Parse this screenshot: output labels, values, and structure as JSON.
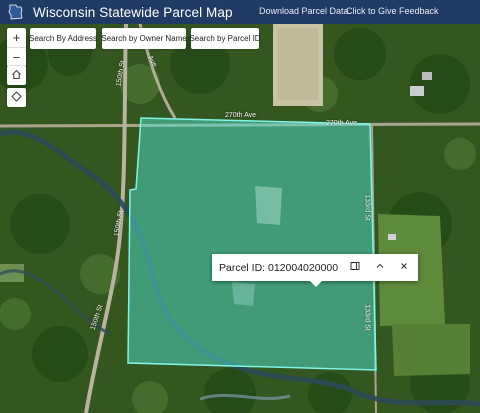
{
  "header": {
    "title": "Wisconsin Statewide Parcel Map",
    "download_link": "Download Parcel Data",
    "feedback_link": "Click to Give Feedback"
  },
  "map_controls": {
    "zoom_in": "+",
    "zoom_out": "−",
    "home_icon": "home-icon",
    "locate_icon": "locate-icon"
  },
  "search": {
    "address_label": "Search By Address",
    "owner_label": "Search by Owner Name",
    "parcel_label": "Search by Parcel ID"
  },
  "roads": {
    "road_top_left": "270th Ave",
    "road_top_right": "270th Ave",
    "road_left_top": "150th St",
    "road_left_mid": "150th St",
    "road_left_bottom": "150th St",
    "road_right_top": "133rd St",
    "road_right_bottom": "133rd St",
    "road_curve": "Ave"
  },
  "popup": {
    "title": "Parcel ID: 012004020000",
    "dock_icon": "dock-icon",
    "collapse_icon": "chevron-up-icon",
    "close_icon": "close-icon"
  },
  "colors": {
    "header_bg": "#1f3a63",
    "parcel_fill": "#4ee0d0",
    "parcel_outline": "#7ff6e8"
  }
}
